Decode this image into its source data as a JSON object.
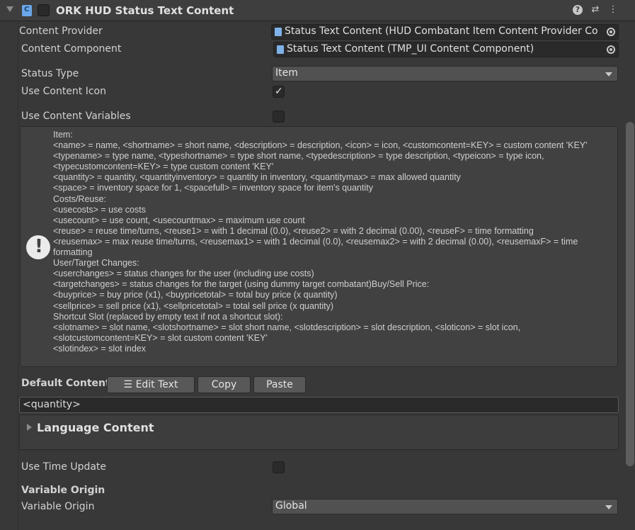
{
  "header": {
    "title": "ORK HUD Status Text Content",
    "icons": [
      "fold-arrow-icon",
      "script-icon",
      "help-icon",
      "preset-icon",
      "menu-icon"
    ]
  },
  "fields": {
    "content_provider": {
      "label": "Content Provider",
      "value": "Status Text Content (HUD Combatant Item Content Provider Co"
    },
    "content_component": {
      "label": "Content Component",
      "value": "Status Text Content (TMP_UI Content Component)"
    },
    "status_type": {
      "label": "Status Type",
      "value": "Item"
    },
    "use_content_icon": {
      "label": "Use Content Icon",
      "checked": true
    },
    "use_content_variables": {
      "label": "Use Content Variables",
      "checked": false
    }
  },
  "help": {
    "lines": [
      "Item:",
      "<name> = name, <shortname> = short name, <description> = description, <icon> = icon, <customcontent=KEY> = custom content 'KEY'",
      "<typename> = type name, <typeshortname> = type short name, <typedescription> = type description, <typeicon> = type icon, <typecustomcontent=KEY> = type custom content 'KEY'",
      "<quantity> = quantity, <quantityinventory> = quantity in inventory, <quantitymax> = max allowed quantity",
      "<space> = inventory space for 1, <spacefull> = inventory space for item's quantity",
      "Costs/Reuse:",
      "<usecosts> = use costs",
      "<usecount> = use count, <usecountmax> = maximum use count",
      "<reuse> = reuse time/turns, <reuse1> = with 1 decimal (0.0), <reuse2> = with 2 decimal (0.00), <reuseF> = time formatting",
      "<reusemax> = max reuse time/turns, <reusemax1> = with 1 decimal (0.0), <reusemax2> = with 2 decimal (0.00), <reusemaxF> = time formatting",
      "User/Target Changes:",
      "<userchanges> = status changes for the user (including use costs)",
      "<targetchanges> = status changes for the target (using dummy target combatant)Buy/Sell Price:",
      "<buyprice> = buy price (x1), <buypricetotal> = total buy price (x quantity)",
      "<sellprice> = sell price (x1), <sellpricetotal> = total sell price (x quantity)",
      "Shortcut Slot (replaced by empty text if not a shortcut slot):",
      "<slotname> = slot name, <slotshortname> = slot short name, <slotdescription> = slot description, <sloticon> = slot icon, <slotcustomcontent=KEY> = slot custom content 'KEY'",
      "<slotindex> = slot index"
    ]
  },
  "default_content": {
    "label": "Default Content",
    "edit_text_label": "Edit Text",
    "copy_label": "Copy",
    "paste_label": "Paste",
    "value": "<quantity>"
  },
  "language_content": {
    "title": "Language Content"
  },
  "time_update": {
    "label": "Use Time Update",
    "checked": false
  },
  "variable_origin": {
    "section_title": "Variable Origin",
    "label": "Variable Origin",
    "value": "Global"
  }
}
